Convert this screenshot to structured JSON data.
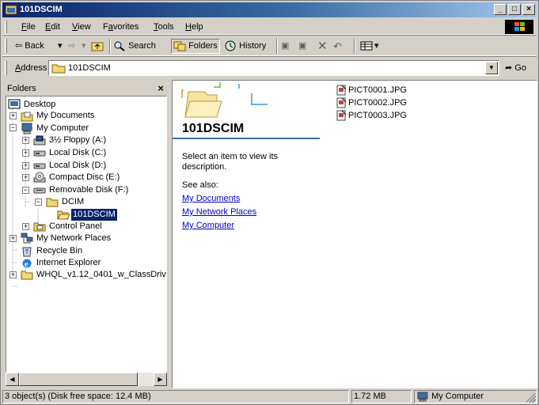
{
  "window": {
    "title": "101DSCIM"
  },
  "menu": [
    {
      "label": "File",
      "key": "F"
    },
    {
      "label": "Edit",
      "key": "E"
    },
    {
      "label": "View",
      "key": "V"
    },
    {
      "label": "Favorites",
      "key": "a"
    },
    {
      "label": "Tools",
      "key": "T"
    },
    {
      "label": "Help",
      "key": "H"
    }
  ],
  "toolbar": {
    "back": "Back",
    "search": "Search",
    "folders": "Folders",
    "history": "History"
  },
  "address": {
    "label": "Address",
    "value": "101DSCIM",
    "go": "Go"
  },
  "folders_pane": {
    "title": "Folders",
    "tree": [
      {
        "label": "Desktop",
        "icon": "desktop-icon"
      },
      {
        "label": "My Documents",
        "icon": "folder-icon"
      },
      {
        "label": "My Computer",
        "icon": "computer-icon"
      },
      {
        "label": "3½ Floppy (A:)",
        "icon": "floppy-icon"
      },
      {
        "label": "Local Disk (C:)",
        "icon": "disk-icon"
      },
      {
        "label": "Local Disk (D:)",
        "icon": "disk-icon"
      },
      {
        "label": "Compact Disc (E:)",
        "icon": "cd-icon"
      },
      {
        "label": "Removable Disk (F:)",
        "icon": "removable-disk-icon"
      },
      {
        "label": "DCIM",
        "icon": "folder-open-icon"
      },
      {
        "label": "101DSCIM",
        "icon": "folder-open-icon"
      },
      {
        "label": "Control Panel",
        "icon": "control-panel-icon"
      },
      {
        "label": "My Network Places",
        "icon": "network-icon"
      },
      {
        "label": "Recycle Bin",
        "icon": "recycle-bin-icon"
      },
      {
        "label": "Internet Explorer",
        "icon": "ie-icon"
      },
      {
        "label": "WHQL_v1.12_0401_w_ClassDriv",
        "icon": "folder-icon"
      }
    ]
  },
  "content": {
    "heading": "101DSCIM",
    "description": "Select an item to view its description.",
    "see_also": "See also:",
    "links": [
      "My Documents",
      "My Network Places",
      "My Computer"
    ],
    "files": [
      "PICT0001.JPG",
      "PICT0002.JPG",
      "PICT0003.JPG"
    ]
  },
  "status": {
    "objects": "3 object(s) (Disk free space: 12.4 MB)",
    "size": "1.72 MB",
    "zone": "My Computer"
  }
}
